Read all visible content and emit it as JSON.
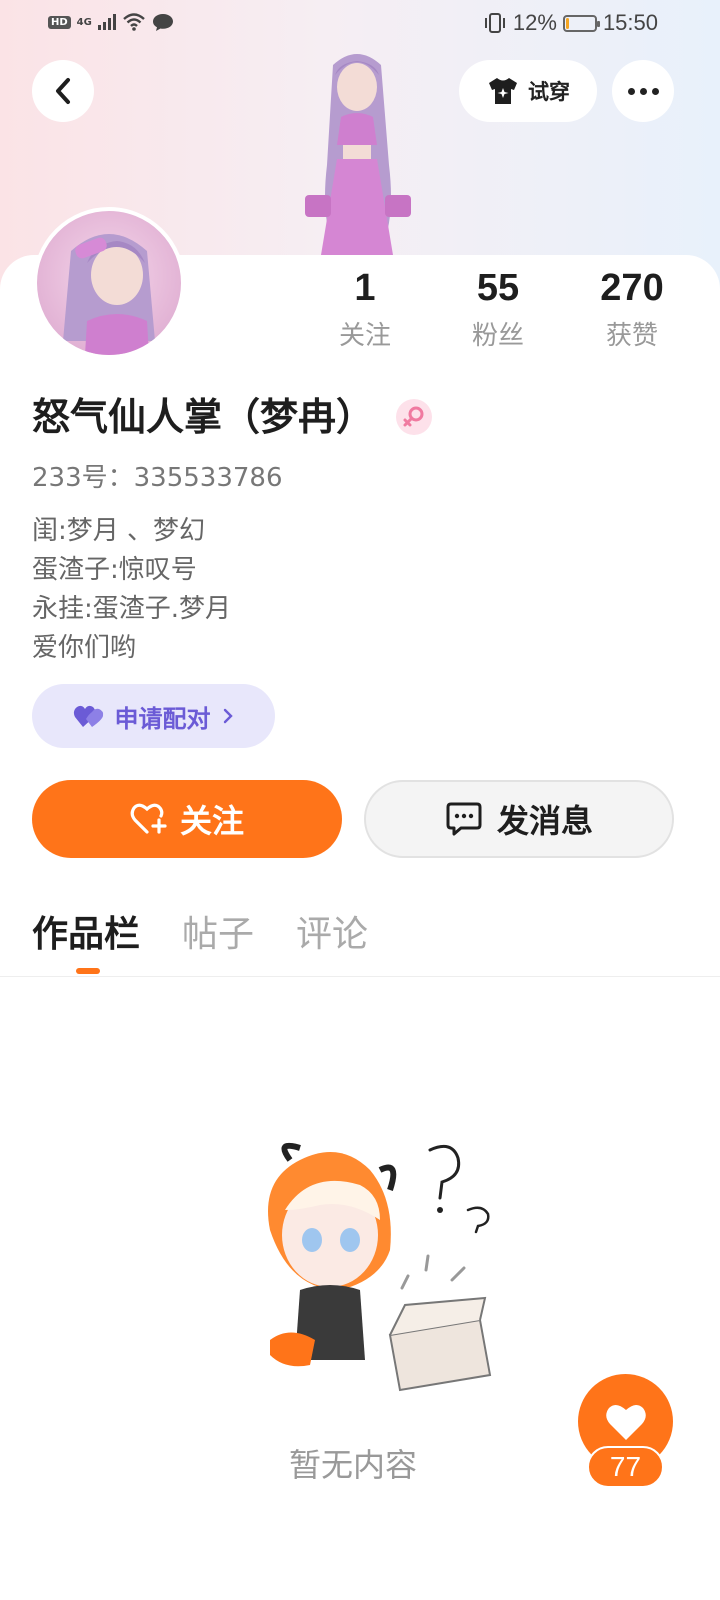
{
  "status_bar": {
    "hd_label": "HD",
    "network_label": "4G",
    "battery_percent_text": "12%",
    "battery_level": 0.12,
    "time": "15:50"
  },
  "header": {
    "tryon_label": "试穿"
  },
  "stats": [
    {
      "value": "1",
      "label": "关注"
    },
    {
      "value": "55",
      "label": "粉丝"
    },
    {
      "value": "270",
      "label": "获赞"
    }
  ],
  "profile": {
    "username": "怒气仙人掌（梦冉）",
    "gender": "female",
    "uid_text": "233号：335533786",
    "bio_lines": [
      "闺:梦月 、梦幻",
      "蛋渣子:惊叹号",
      "永挂:蛋渣子.梦月",
      "爱你们哟"
    ]
  },
  "actions": {
    "pair_label": "申请配对",
    "follow_label": "关注",
    "message_label": "发消息"
  },
  "tabs": [
    {
      "label": "作品栏",
      "active": true
    },
    {
      "label": "帖子",
      "active": false
    },
    {
      "label": "评论",
      "active": false
    }
  ],
  "empty_state": {
    "text": "暂无内容"
  },
  "like_fab": {
    "count": "77"
  },
  "colors": {
    "accent": "#ff7419",
    "pair_purple": "#6b5bd6",
    "pair_bg": "#e8e7fb",
    "female_pink": "#f07aa0"
  }
}
